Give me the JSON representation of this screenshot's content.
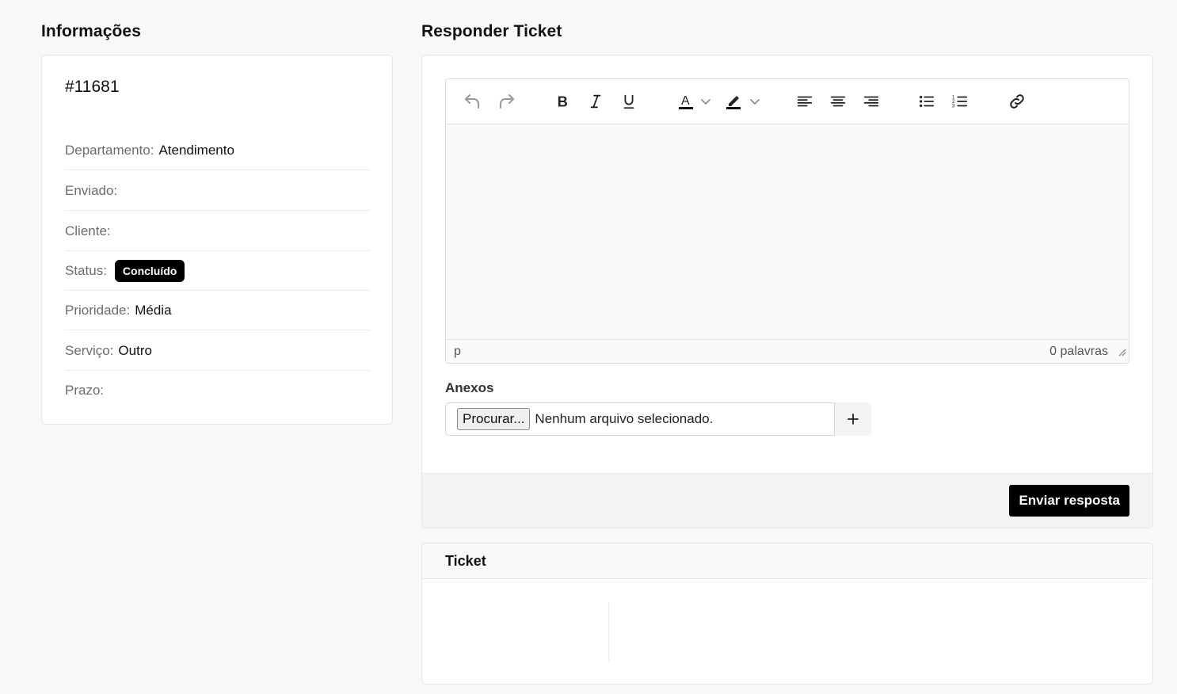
{
  "info": {
    "title": "Informações",
    "ticket_number": "#11681",
    "rows": [
      {
        "label": "Departamento:",
        "value": "Atendimento"
      },
      {
        "label": "Enviado:",
        "value": ""
      },
      {
        "label": "Cliente:",
        "value": ""
      },
      {
        "label": "Status:",
        "value": "Concluído"
      },
      {
        "label": "Prioridade:",
        "value": "Média"
      },
      {
        "label": "Serviço:",
        "value": "Outro"
      },
      {
        "label": "Prazo:",
        "value": ""
      }
    ]
  },
  "reply": {
    "title": "Responder Ticket",
    "toolbar": [
      "undo-icon",
      "redo-icon",
      "bold-icon",
      "italic-icon",
      "underline-icon",
      "text-color-icon",
      "highlight-icon",
      "align-left-icon",
      "align-center-icon",
      "align-right-icon",
      "bullet-list-icon",
      "numbered-list-icon",
      "link-icon"
    ],
    "statusbar": {
      "path": "p",
      "word_count": "0 palavras"
    },
    "attachments_label": "Anexos",
    "browse_label": "Procurar...",
    "no_file_text": "Nenhum arquivo selecionado.",
    "add_label": "+",
    "send_label": "Enviar resposta"
  },
  "ticket": {
    "title": "Ticket"
  },
  "colors": {
    "background": "#f8f8f8",
    "status_badge": "#000000",
    "primary_button": "#000000"
  }
}
